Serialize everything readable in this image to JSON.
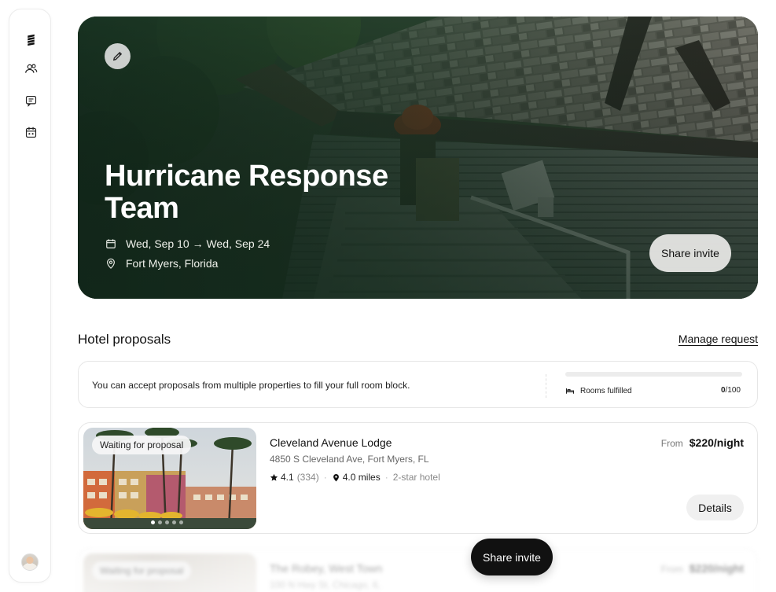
{
  "sidebar": {
    "items": [
      {
        "name": "logo",
        "icon": "stack-logo-icon"
      },
      {
        "name": "team",
        "icon": "users-icon"
      },
      {
        "name": "messages",
        "icon": "chat-icon"
      },
      {
        "name": "calendar",
        "icon": "calendar-icon"
      }
    ]
  },
  "hero": {
    "title": "Hurricane Response Team",
    "dates": "Wed, Sep 10 → Wed, Sep 24",
    "location": "Fort Myers, Florida",
    "share_label": "Share invite"
  },
  "proposals": {
    "title": "Hotel proposals",
    "manage_label": "Manage request",
    "info_text": "You can accept proposals from multiple properties to fill your full room block.",
    "rooms_label": "Rooms fulfilled",
    "rooms_filled": "0",
    "rooms_total": "/100",
    "rooms_fraction": 0
  },
  "cards": [
    {
      "badge": "Waiting for proposal",
      "name": "Cleveland Avenue Lodge",
      "address": "4850 S Cleveland Ave, Fort Myers, FL",
      "rating": "4.1",
      "reviews": "(334)",
      "distance": "4.0 miles",
      "stars": "2-star hotel",
      "price_prefix": "From",
      "price": "$220/night",
      "details_label": "Details"
    },
    {
      "badge": "Waiting for proposal",
      "name": "The Robey, West Town",
      "address": "100 N Hwy St, Chicago, IL",
      "price_prefix": "From",
      "price": "$220/night"
    }
  ],
  "floating": {
    "share_label": "Share invite"
  },
  "colors": {
    "accent": "#111111",
    "hero_overlay": "#1f3a28"
  }
}
